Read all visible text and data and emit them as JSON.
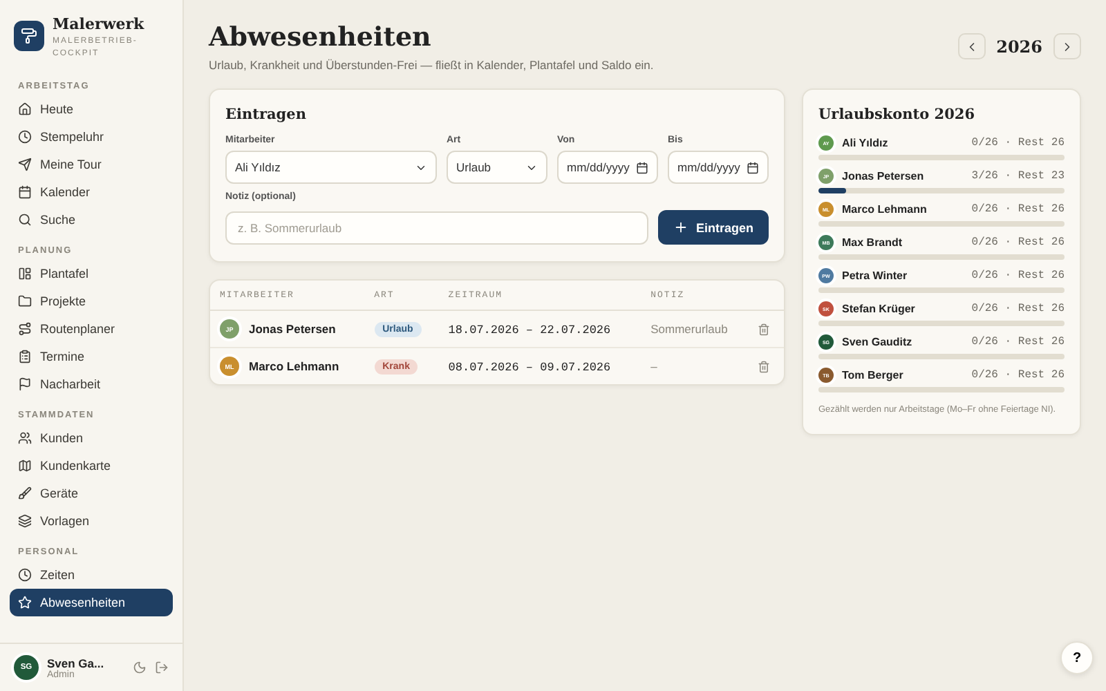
{
  "brand": {
    "name": "Malerwerk",
    "subtitle": "MALERBETRIEB-COCKPIT"
  },
  "sidebar": {
    "sections": [
      {
        "label": "ARBEITSTAG",
        "items": [
          {
            "label": "Heute",
            "selected": false
          },
          {
            "label": "Stempeluhr",
            "selected": false
          },
          {
            "label": "Meine Tour",
            "selected": false
          },
          {
            "label": "Kalender",
            "selected": false
          },
          {
            "label": "Suche",
            "selected": false
          }
        ]
      },
      {
        "label": "PLANUNG",
        "items": [
          {
            "label": "Plantafel",
            "selected": false
          },
          {
            "label": "Projekte",
            "selected": false
          },
          {
            "label": "Routenplaner",
            "selected": false
          },
          {
            "label": "Termine",
            "selected": false
          },
          {
            "label": "Nacharbeit",
            "selected": false
          }
        ]
      },
      {
        "label": "STAMMDATEN",
        "items": [
          {
            "label": "Kunden",
            "selected": false
          },
          {
            "label": "Kundenkarte",
            "selected": false
          },
          {
            "label": "Geräte",
            "selected": false
          },
          {
            "label": "Vorlagen",
            "selected": false
          }
        ]
      },
      {
        "label": "PERSONAL",
        "items": [
          {
            "label": "Zeiten",
            "selected": false
          },
          {
            "label": "Abwesenheiten",
            "selected": true
          }
        ]
      }
    ],
    "user": {
      "initials": "SG",
      "name": "Sven Ga...",
      "role": "Admin"
    }
  },
  "header": {
    "title": "Abwesenheiten",
    "subtitle": "Urlaub, Krankheit und Überstunden-Frei — fließt in Kalender, Plantafel und Saldo ein.",
    "year": "2026"
  },
  "form": {
    "title": "Eintragen",
    "fields": [
      {
        "kind": "select",
        "label": "Mitarbeiter",
        "value": "Ali Yıldız"
      },
      {
        "kind": "select",
        "label": "Art",
        "value": "Urlaub"
      },
      {
        "kind": "date",
        "label": "Von",
        "placeholder": "mm/dd/yyyy"
      },
      {
        "kind": "date",
        "label": "Bis",
        "placeholder": "mm/dd/yyyy"
      }
    ],
    "note": {
      "label": "Notiz (optional)",
      "placeholder": "z. B. Sommerurlaub"
    },
    "submit": "Eintragen"
  },
  "table": {
    "columns": [
      "MITARBEITER",
      "ART",
      "ZEITRAUM",
      "NOTIZ"
    ],
    "rows": [
      {
        "initials": "JP",
        "color": "#7fa06a",
        "name": "Jonas Petersen",
        "type": {
          "kind": "vacation",
          "label": "Urlaub"
        },
        "period": "18.07.2026 – 22.07.2026",
        "note": "Sommerurlaub"
      },
      {
        "initials": "ML",
        "color": "#c98f2e",
        "name": "Marco Lehmann",
        "type": {
          "kind": "sick",
          "label": "Krank"
        },
        "period": "08.07.2026 – 09.07.2026",
        "note": "–"
      }
    ]
  },
  "account": {
    "title": "Urlaubskonto 2026",
    "people": [
      {
        "initials": "AY",
        "color": "#5f9a4e",
        "name": "Ali Yıldız",
        "reading": "0/26 · Rest 26",
        "level": 0
      },
      {
        "initials": "JP",
        "color": "#7fa06a",
        "name": "Jonas Petersen",
        "reading": "3/26 · Rest 23",
        "level": 0.115
      },
      {
        "initials": "ML",
        "color": "#c98f2e",
        "name": "Marco Lehmann",
        "reading": "0/26 · Rest 26",
        "level": 0
      },
      {
        "initials": "MB",
        "color": "#3d7a5a",
        "name": "Max Brandt",
        "reading": "0/26 · Rest 26",
        "level": 0
      },
      {
        "initials": "PW",
        "color": "#4f7aa0",
        "name": "Petra Winter",
        "reading": "0/26 · Rest 26",
        "level": 0
      },
      {
        "initials": "SK",
        "color": "#c0503e",
        "name": "Stefan Krüger",
        "reading": "0/26 · Rest 26",
        "level": 0
      },
      {
        "initials": "SG",
        "color": "#215a3a",
        "name": "Sven Gauditz",
        "reading": "0/26 · Rest 26",
        "level": 0
      },
      {
        "initials": "TB",
        "color": "#8a5a2e",
        "name": "Tom Berger",
        "reading": "0/26 · Rest 26",
        "level": 0
      }
    ],
    "footnote": "Gezählt werden nur Arbeitstage (Mo–Fr ohne Feiertage NI)."
  },
  "help": "?"
}
